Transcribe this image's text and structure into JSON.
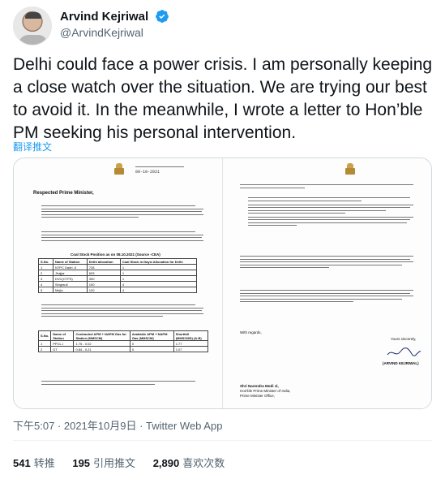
{
  "author": {
    "display_name": "Arvind Kejriwal",
    "handle": "@ArvindKejriwal",
    "verified": true
  },
  "tweet": {
    "text": "Delhi could face a power crisis. I am personally keeping a close watch over the situation. We are trying our best to avoid it. In the meanwhile, I wrote a letter to Hon’ble PM seeking his personal intervention.",
    "translate_label": "翻译推文",
    "timestamp": "下午5:07 · 2021年10月9日 · Twitter Web App"
  },
  "stats": {
    "retweets_count": "541",
    "retweets_label": "转推",
    "quotes_count": "195",
    "quotes_label": "引用推文",
    "likes_count": "2,890",
    "likes_label": "喜欢次数"
  },
  "letter": {
    "date": "09-10-2021",
    "salutation": "Respected Prime Minister,",
    "coal_table_caption": "Coal Stock Position as on 08.10.2021 (Source -CEA)",
    "coal_table": {
      "headers": [
        "S.No.",
        "Name of Station",
        "Dethi allocation",
        "Coal Stock in Days/ Allocation for Delhi"
      ],
      "rows": [
        [
          "1",
          "NTPC Dadri -II",
          "728",
          "1"
        ],
        [
          "2",
          "Jhajjar",
          "693",
          "1"
        ],
        [
          "3",
          "DVC(CTPS)",
          "300",
          "1"
        ],
        [
          "4",
          "Singrauli",
          "100",
          "4"
        ],
        [
          "5",
          "Mejia",
          "100",
          "4"
        ]
      ]
    },
    "gas_table": {
      "headers": [
        "S.No.",
        "Name of Station",
        "Contracted APM + NAPM Gas for Station (MMSCM)",
        "Available APM + NAPM Gas (MMSCM)",
        "Shortfall (MMSCMD) (A-B)"
      ],
      "rows": [
        [
          "1",
          "PPCL-I",
          "1.75 - 0.02",
          "0",
          "1.77"
        ],
        [
          "2",
          "GT",
          "0.84 - 0.21",
          "0",
          "1.07"
        ]
      ]
    },
    "regards": "With regards,",
    "sincerely": "Yours sincerely,",
    "signatory": "(ARVIND KEJRIWAL)",
    "addressee": [
      "Shri Narendra Modi Ji,",
      "Hon'ble Prime Minister of India,",
      "Prime Minister Office,"
    ]
  },
  "colors": {
    "accent": "#1d9bf0",
    "muted": "#536471",
    "text": "#0f1419"
  }
}
